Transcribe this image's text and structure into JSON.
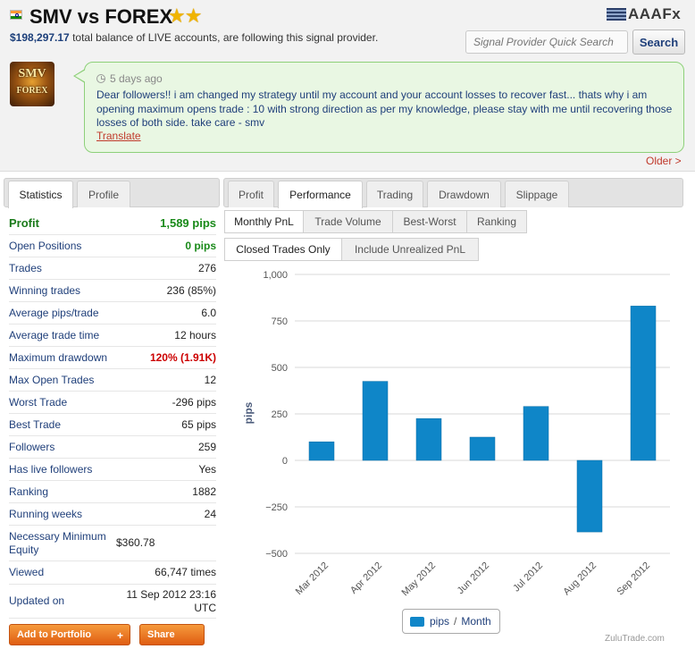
{
  "header": {
    "title": "SMV vs FOREX",
    "stars": "★★",
    "balance": "$198,297.17",
    "balance_text": "total balance of LIVE accounts, are following this signal provider.",
    "broker_logo": "AAAFx",
    "search_placeholder": "Signal Provider Quick Search",
    "search_button": "Search"
  },
  "avatar": {
    "line1": "SMV",
    "line2": "FOREX"
  },
  "post": {
    "time": "5 days ago",
    "text": "Dear followers!! i am changed my strategy until my account and your account losses to recover fast... thats why i am opening maximum opens trade : 10 with strong direction as per my knowledge, please stay with me until recovering those losses of both side. take care - smv",
    "translate": "Translate",
    "older": "Older >"
  },
  "left_tabs": [
    "Statistics",
    "Profile"
  ],
  "stats": [
    {
      "label": "Profit",
      "value": "1,589 pips"
    },
    {
      "label": "Open Positions",
      "value": "0 pips"
    },
    {
      "label": "Trades",
      "value": "276"
    },
    {
      "label": "Winning trades",
      "value": "236 (85%)"
    },
    {
      "label": "Average pips/trade",
      "value": "6.0"
    },
    {
      "label": "Average trade time",
      "value": "12 hours"
    },
    {
      "label": "Maximum drawdown",
      "value": "120% (1.91K)"
    },
    {
      "label": "Max Open Trades",
      "value": "12"
    },
    {
      "label": "Worst Trade",
      "value": "-296 pips"
    },
    {
      "label": "Best Trade",
      "value": "65 pips"
    },
    {
      "label": "Followers",
      "value": "259"
    },
    {
      "label": "Has live followers",
      "value": "Yes"
    },
    {
      "label": "Ranking",
      "value": "1882"
    },
    {
      "label": "Running weeks",
      "value": "24"
    },
    {
      "label": "Necessary Minimum Equity",
      "value": "$360.78"
    },
    {
      "label": "Viewed",
      "value": "66,747 times"
    },
    {
      "label": "Updated on",
      "value": "11 Sep 2012 23:16 UTC"
    }
  ],
  "buttons": {
    "add_portfolio": "Add to Portfolio",
    "share": "Share"
  },
  "right_tabs": [
    "Profit",
    "Performance",
    "Trading",
    "Drawdown",
    "Slippage"
  ],
  "sub_tabs": [
    "Monthly PnL",
    "Trade Volume",
    "Best-Worst",
    "Ranking"
  ],
  "filter_tabs": [
    "Closed Trades Only",
    "Include Unrealized PnL"
  ],
  "legend": {
    "series": "pips",
    "sep": "/",
    "period": "Month"
  },
  "credit": "ZuluTrade.com",
  "colors": {
    "bar": "#0f86c8",
    "profit_green": "#1a8a1a",
    "drawdown_red": "#cc0000",
    "link": "#1f3f7a"
  },
  "chart_data": {
    "type": "bar",
    "categories": [
      "Mar 2012",
      "Apr 2012",
      "May 2012",
      "Jun 2012",
      "Jul 2012",
      "Aug 2012",
      "Sep 2012"
    ],
    "values": [
      100,
      425,
      225,
      125,
      290,
      -385,
      830
    ],
    "ylabel": "pips",
    "ylim": [
      -500,
      1000
    ],
    "yticks": [
      "1,000",
      "750",
      "500",
      "250",
      "0",
      "−250",
      "−500"
    ],
    "ytick_values": [
      1000,
      750,
      500,
      250,
      0,
      -250,
      -500
    ],
    "grid": true,
    "legend": "bottom-center"
  }
}
